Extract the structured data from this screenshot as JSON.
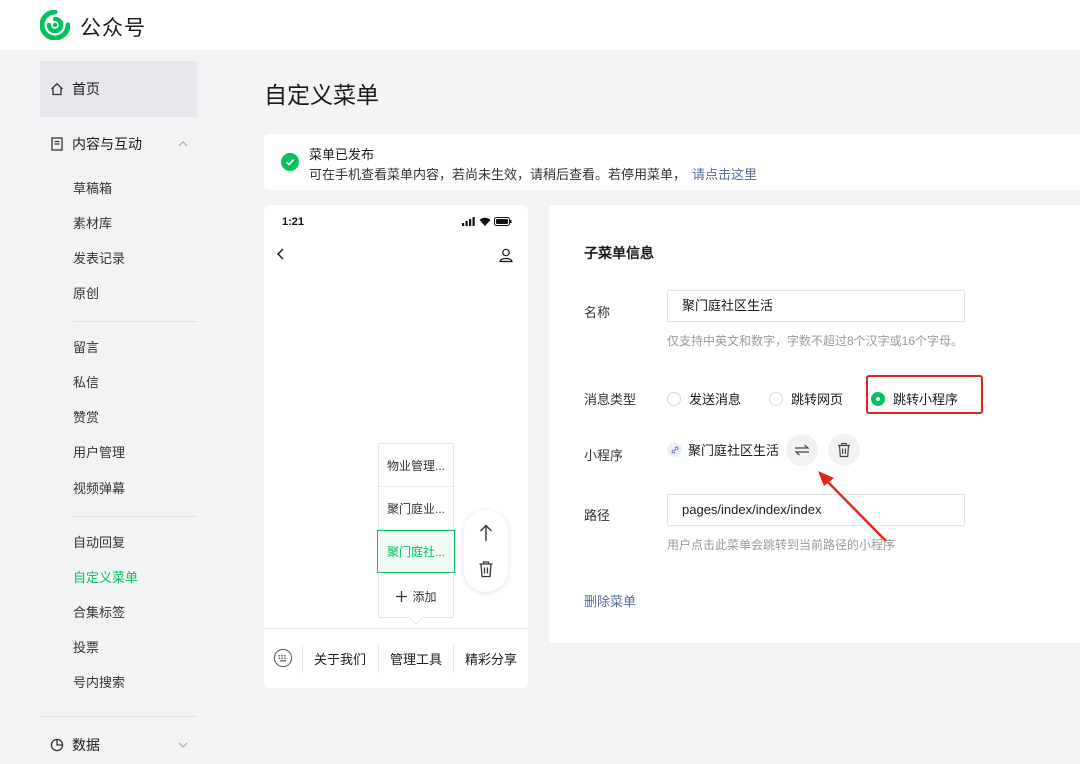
{
  "header": {
    "brand": "公众号"
  },
  "sidebar": {
    "home": "首页",
    "content_group": "内容与互动",
    "items_a": [
      "草稿箱",
      "素材库",
      "发表记录",
      "原创"
    ],
    "items_b": [
      "留言",
      "私信",
      "赞赏",
      "用户管理",
      "视频弹幕"
    ],
    "items_c": [
      "自动回复",
      "自定义菜单",
      "合集标签",
      "投票",
      "号内搜索"
    ],
    "active_item": "自定义菜单",
    "data_group": "数据"
  },
  "main": {
    "title": "自定义菜单",
    "banner": {
      "status": "菜单已发布",
      "message": "可在手机查看菜单内容，若尚未生效，请稍后查看。若停用菜单，",
      "link": "请点击这里"
    }
  },
  "phone": {
    "time": "1:21",
    "submenu": [
      "物业管理...",
      "聚门庭业...",
      "聚门庭社..."
    ],
    "submenu_selected_index": 2,
    "add_label": "添加",
    "bottom_menu": [
      "关于我们",
      "管理工具",
      "精彩分享"
    ]
  },
  "panel": {
    "title": "子菜单信息",
    "name_label": "名称",
    "name_value": "聚门庭社区生活",
    "name_hint": "仅支持中英文和数字，字数不超过8个汉字或16个字母。",
    "msg_type_label": "消息类型",
    "msg_types": [
      "发送消息",
      "跳转网页",
      "跳转小程序"
    ],
    "msg_type_selected": "跳转小程序",
    "miniprogram_label": "小程序",
    "miniprogram_value": "聚门庭社区生活",
    "path_label": "路径",
    "path_value": "pages/index/index/index",
    "path_hint": "用户点击此菜单会跳转到当前路径的小程序",
    "delete_label": "删除菜单"
  },
  "colors": {
    "accent": "#07c160",
    "link": "#576b95",
    "annotation": "#e1251b"
  }
}
